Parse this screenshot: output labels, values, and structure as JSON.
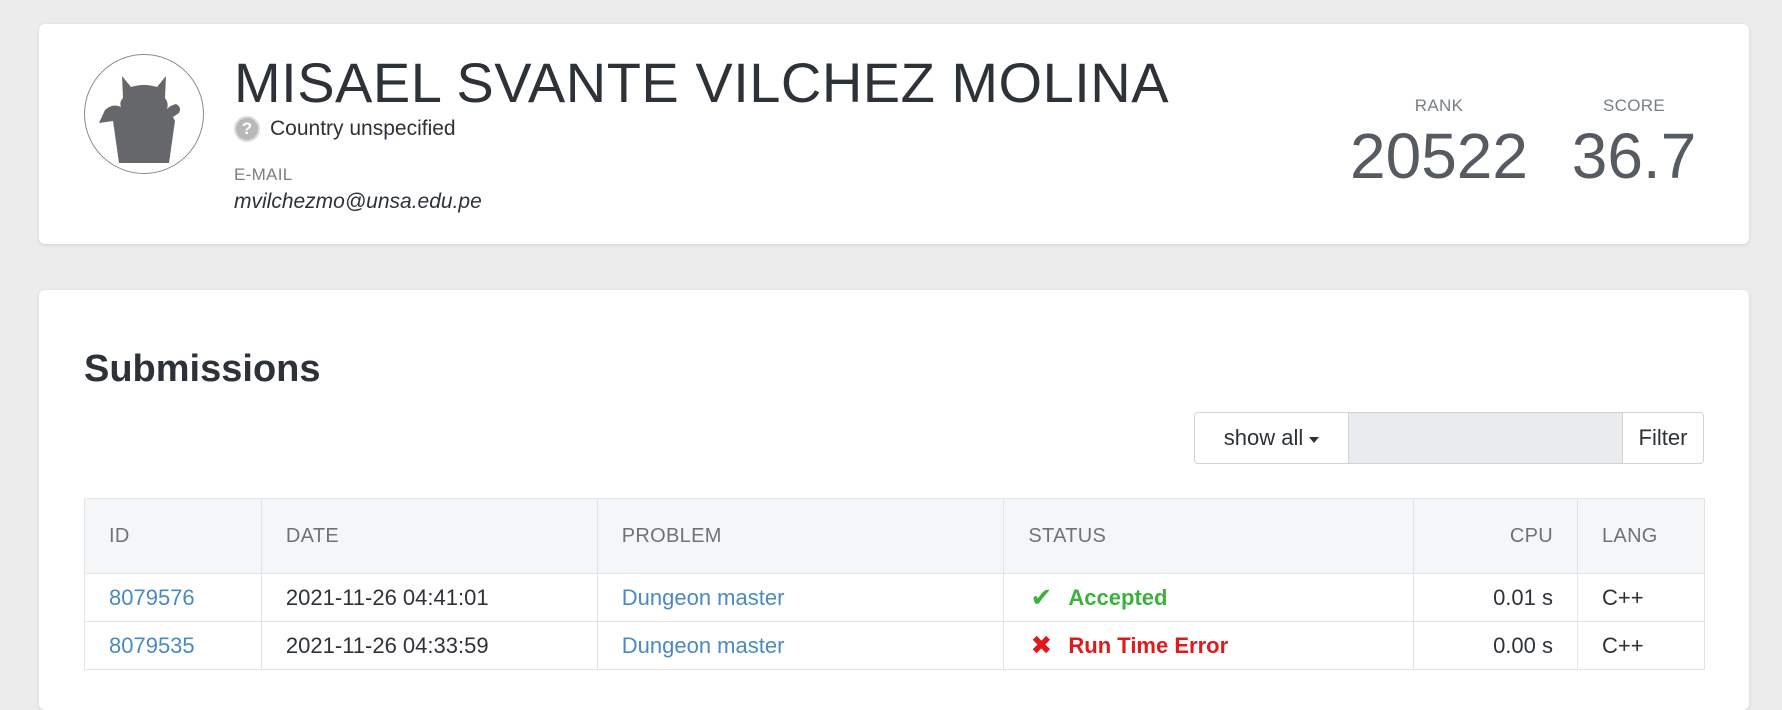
{
  "profile": {
    "name": "MISAEL SVANTE VILCHEZ MOLINA",
    "country_icon": "?",
    "country": "Country unspecified",
    "email_label": "E-MAIL",
    "email": "mvilchezmo@unsa.edu.pe",
    "rank_label": "RANK",
    "rank": "20522",
    "score_label": "SCORE",
    "score": "36.7"
  },
  "submissions": {
    "title": "Submissions",
    "filter": {
      "dropdown_label": "show all",
      "input_value": "",
      "input_placeholder": "",
      "button_label": "Filter"
    },
    "columns": [
      "ID",
      "DATE",
      "PROBLEM",
      "STATUS",
      "CPU",
      "LANG"
    ],
    "rows": [
      {
        "id": "8079576",
        "date": "2021-11-26 04:41:01",
        "problem": "Dungeon master",
        "status_icon": "✔",
        "status": "Accepted",
        "cpu": "0.01 s",
        "lang": "C++"
      },
      {
        "id": "8079535",
        "date": "2021-11-26 04:33:59",
        "problem": "Dungeon master",
        "status_icon": "✖",
        "status": "Run Time Error",
        "cpu": "0.00 s",
        "lang": "C++"
      }
    ]
  },
  "colors": {
    "accepted": "#3bb33b",
    "error": "#e0191b",
    "link": "#4a89c2"
  }
}
